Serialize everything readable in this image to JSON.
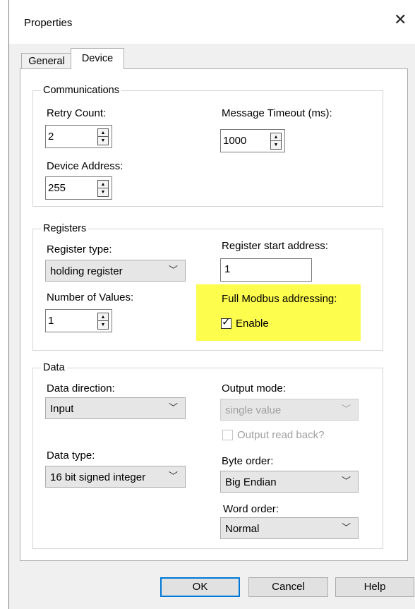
{
  "window": {
    "title": "Properties"
  },
  "tabs": {
    "general": "General",
    "device": "Device"
  },
  "communications": {
    "legend": "Communications",
    "retry_count_label": "Retry Count:",
    "retry_count_value": "2",
    "message_timeout_label": "Message Timeout (ms):",
    "message_timeout_value": "1000",
    "device_address_label": "Device Address:",
    "device_address_value": "255"
  },
  "registers": {
    "legend": "Registers",
    "register_type_label": "Register type:",
    "register_type_value": "holding register",
    "start_address_label": "Register start address:",
    "start_address_value": "1",
    "num_values_label": "Number of Values:",
    "num_values_value": "1",
    "full_modbus_label": "Full Modbus addressing:",
    "enable_label": "Enable",
    "enable_checked": true
  },
  "data": {
    "legend": "Data",
    "direction_label": "Data direction:",
    "direction_value": "Input",
    "output_mode_label": "Output mode:",
    "output_mode_value": "single value",
    "output_readback_label": "Output read back?",
    "output_readback_checked": false,
    "type_label": "Data type:",
    "type_value": "16 bit signed integer",
    "byte_order_label": "Byte order:",
    "byte_order_value": "Big Endian",
    "word_order_label": "Word order:",
    "word_order_value": "Normal"
  },
  "buttons": {
    "ok": "OK",
    "cancel": "Cancel",
    "help": "Help"
  },
  "colors": {
    "highlight": "#fdfd4e",
    "ok_border": "#0078d7"
  }
}
